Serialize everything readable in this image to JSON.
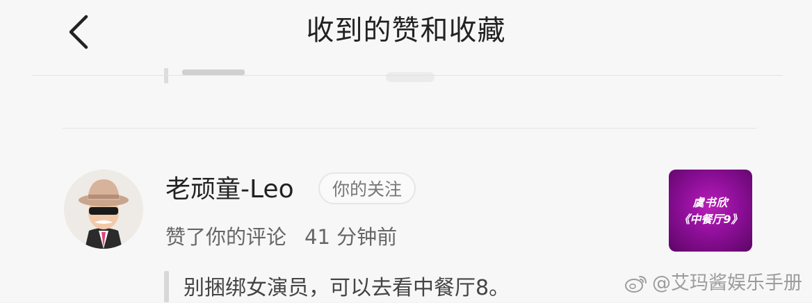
{
  "header": {
    "title": "收到的赞和收藏",
    "back_icon": "chevron-left-icon"
  },
  "notification": {
    "username": "老顽童-Leo",
    "badge": "你的关注",
    "action": "赞了你的评论",
    "time": "41 分钟前",
    "quoted_comment": "别捆绑女演员，可以去看中餐厅8。",
    "thumbnail": {
      "line1": "虞书欣",
      "line2": "《中餐厅9》",
      "color": "#9b13a3"
    }
  },
  "watermark": "@艾玛酱娱乐手册",
  "colors": {
    "background": "#f7f7f7",
    "text": "#222222",
    "secondary_text": "#666666",
    "thumbnail_purple": "#9b13a3"
  }
}
